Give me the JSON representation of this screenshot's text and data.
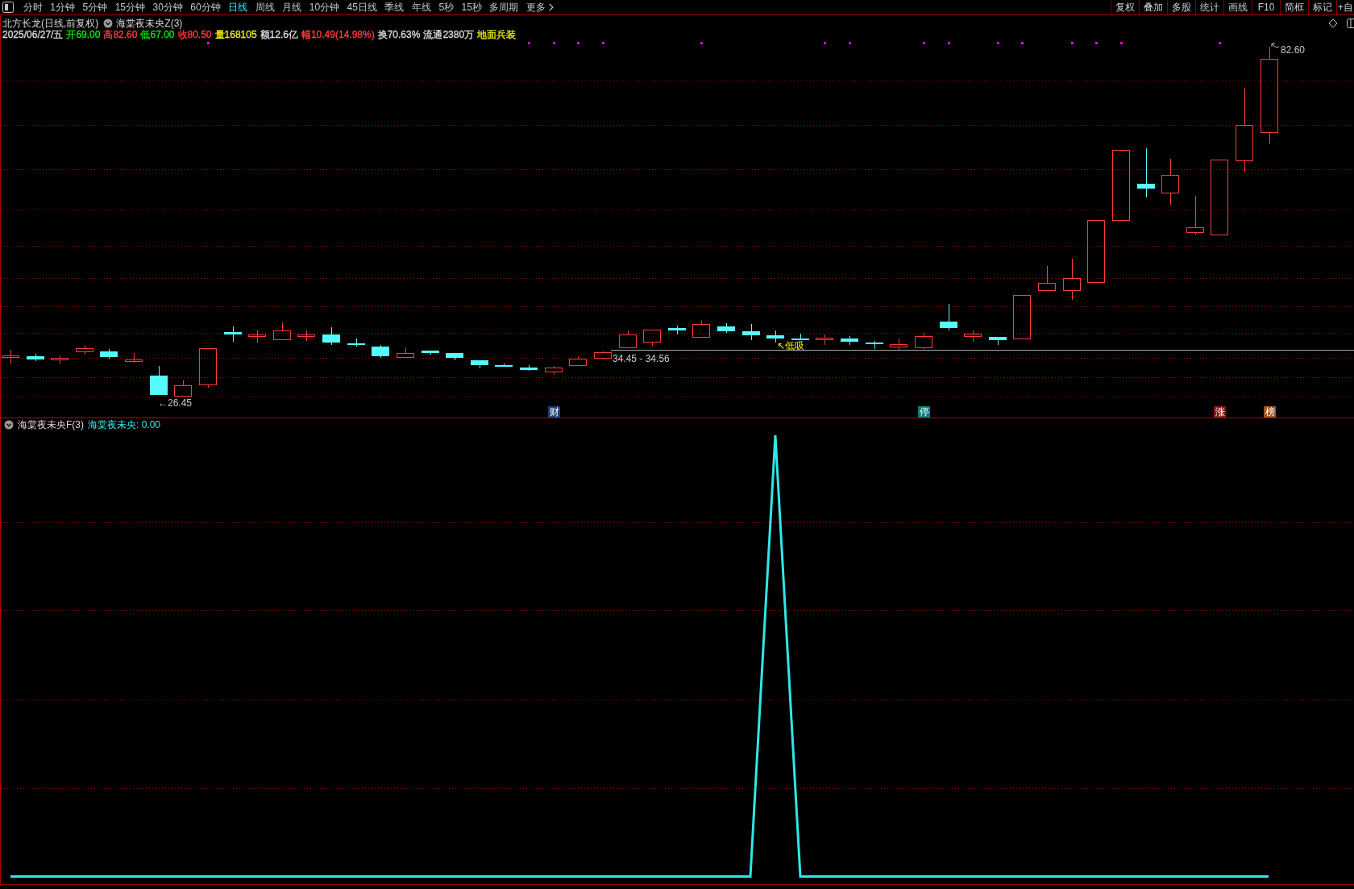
{
  "toolbar": {
    "periods": [
      {
        "label": "分时",
        "selected": false,
        "kind": "period"
      },
      {
        "label": "1分钟",
        "selected": false,
        "kind": "period"
      },
      {
        "label": "5分钟",
        "selected": false,
        "kind": "period"
      },
      {
        "label": "15分钟",
        "selected": false,
        "kind": "period"
      },
      {
        "label": "30分钟",
        "selected": false,
        "kind": "period"
      },
      {
        "label": "60分钟",
        "selected": false,
        "kind": "period"
      },
      {
        "label": "日线",
        "selected": true,
        "kind": "period"
      },
      {
        "label": "周线",
        "selected": false,
        "kind": "period"
      },
      {
        "label": "月线",
        "selected": false,
        "kind": "period"
      },
      {
        "label": "10分钟",
        "selected": false,
        "kind": "period"
      },
      {
        "label": "45日线",
        "selected": false,
        "kind": "period"
      },
      {
        "label": "季线",
        "selected": false,
        "kind": "period"
      },
      {
        "label": "年线",
        "selected": false,
        "kind": "period"
      },
      {
        "label": "5秒",
        "selected": false,
        "kind": "period"
      },
      {
        "label": "15秒",
        "selected": false,
        "kind": "period"
      },
      {
        "label": "多周期",
        "selected": false,
        "kind": "period"
      },
      {
        "label": "更多",
        "selected": false,
        "kind": "menu"
      }
    ],
    "tools": [
      "复权",
      "叠加",
      "多股",
      "统计",
      "画线",
      "F10",
      "简框",
      "标记",
      "+自"
    ]
  },
  "main_panel": {
    "title": "北方长龙(日线,前复权)",
    "indicator": "海棠夜未央Z(3)",
    "quote": [
      {
        "text": "2025/06/27/五",
        "color": "#d8d8d8"
      },
      {
        "text": "开69.00",
        "color": "#00e600"
      },
      {
        "text": "高82.60",
        "color": "#ff3c3c"
      },
      {
        "text": "低67.00",
        "color": "#00e600"
      },
      {
        "text": "收80.50",
        "color": "#ff3c3c"
      },
      {
        "text": "量168105",
        "color": "#e6e600"
      },
      {
        "text": "额12.6亿",
        "color": "#d8d8d8"
      },
      {
        "text": "幅10.49(14.98%)",
        "color": "#ff3c3c"
      },
      {
        "text": "换70.63%",
        "color": "#d8d8d8"
      },
      {
        "text": "流通2380万",
        "color": "#d8d8d8"
      },
      {
        "text": "地面兵装",
        "color": "#e6e600"
      }
    ],
    "high_label": "82.60",
    "low_label": "←26.45",
    "range_label": "34.45 - 34.56",
    "signal_label": "↖低吸",
    "badges": [
      {
        "text": "财",
        "color": "#1e3c7a"
      },
      {
        "text": "停",
        "color": "#0a7878"
      },
      {
        "text": "涨",
        "color": "#8c1414"
      },
      {
        "text": "榜",
        "color": "#9c5420"
      }
    ]
  },
  "sub_panel": {
    "title": "海棠夜未央F(3)",
    "reading": "海棠夜未央: 0.00"
  }
}
